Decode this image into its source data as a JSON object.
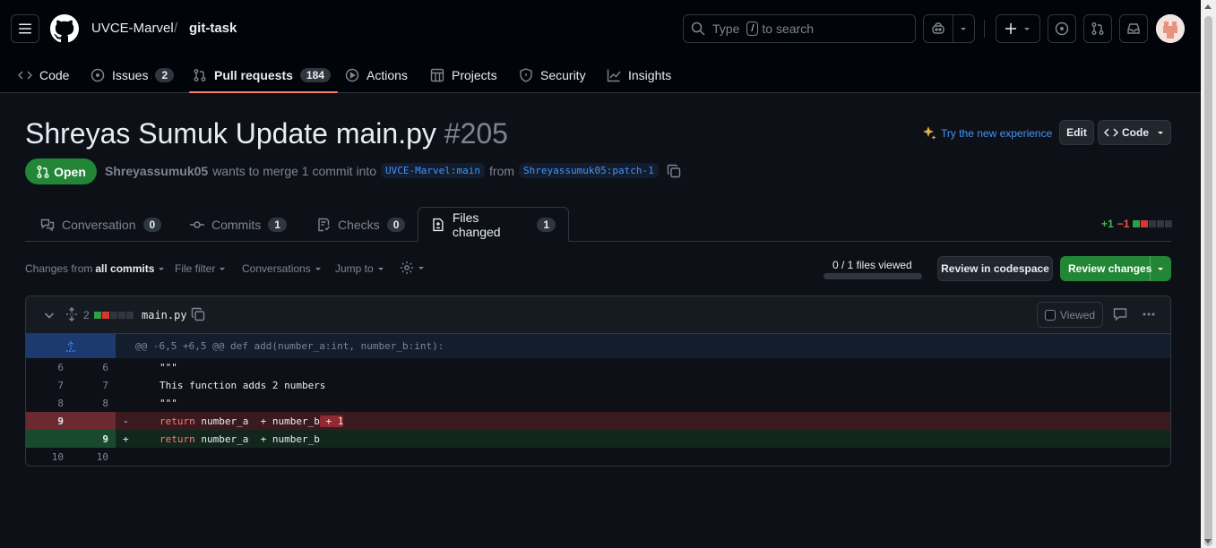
{
  "repo": {
    "owner": "UVCE-Marvel",
    "sep": "/",
    "name": "git-task"
  },
  "search": {
    "type": "Type",
    "key": "/",
    "rest": "to search"
  },
  "nav": {
    "code": "Code",
    "issues": "Issues",
    "issues_count": "2",
    "pulls": "Pull requests",
    "pulls_count": "184",
    "actions": "Actions",
    "projects": "Projects",
    "security": "Security",
    "insights": "Insights"
  },
  "pr": {
    "title": "Shreyas Sumuk Update main.py",
    "number": "#205",
    "state": "Open",
    "author": "Shreyassumuk05",
    "merge_text": "wants to merge 1 commit into",
    "base": "UVCE-Marvel:main",
    "from": "from",
    "head": "Shreyassumuk05:patch-1",
    "try_new": "Try the new experience",
    "edit": "Edit",
    "code_btn": "Code"
  },
  "tabs": {
    "conversation": "Conversation",
    "conversation_count": "0",
    "commits": "Commits",
    "commits_count": "1",
    "checks": "Checks",
    "checks_count": "0",
    "files": "Files changed",
    "files_count": "1"
  },
  "diffstat": {
    "added": "+1",
    "removed": "−1"
  },
  "toolbar": {
    "changes_from": "Changes from",
    "all_commits": "all commits",
    "file_filter": "File filter",
    "conversations": "Conversations",
    "jump_to": "Jump to",
    "files_viewed": "0 / 1 files viewed",
    "files_viewed_fraction": 0,
    "review_codespace": "Review in codespace",
    "review_changes": "Review changes"
  },
  "file": {
    "changes": "2",
    "name": "main.py",
    "viewed": "Viewed",
    "hunk": "@@ -6,5 +6,5 @@ def add(number_a:int, number_b:int):",
    "lines": [
      {
        "old": "6",
        "new": "6",
        "sign": "",
        "code": "\"\"\""
      },
      {
        "old": "7",
        "new": "7",
        "sign": "",
        "code": "This function adds 2 numbers"
      },
      {
        "old": "8",
        "new": "8",
        "sign": "",
        "code": "\"\"\""
      },
      {
        "old": "9",
        "new": "",
        "sign": "-",
        "kw": "return",
        "code": " number_a  + number_b",
        "removed": " + 1"
      },
      {
        "old": "",
        "new": "9",
        "sign": "+",
        "kw": "return",
        "code": " number_a  + number_b"
      },
      {
        "old": "10",
        "new": "10",
        "sign": "",
        "code": ""
      }
    ]
  },
  "colors": {
    "accent_green": "#238636",
    "link_blue": "#4493f8",
    "nav_underline": "#f78166"
  }
}
